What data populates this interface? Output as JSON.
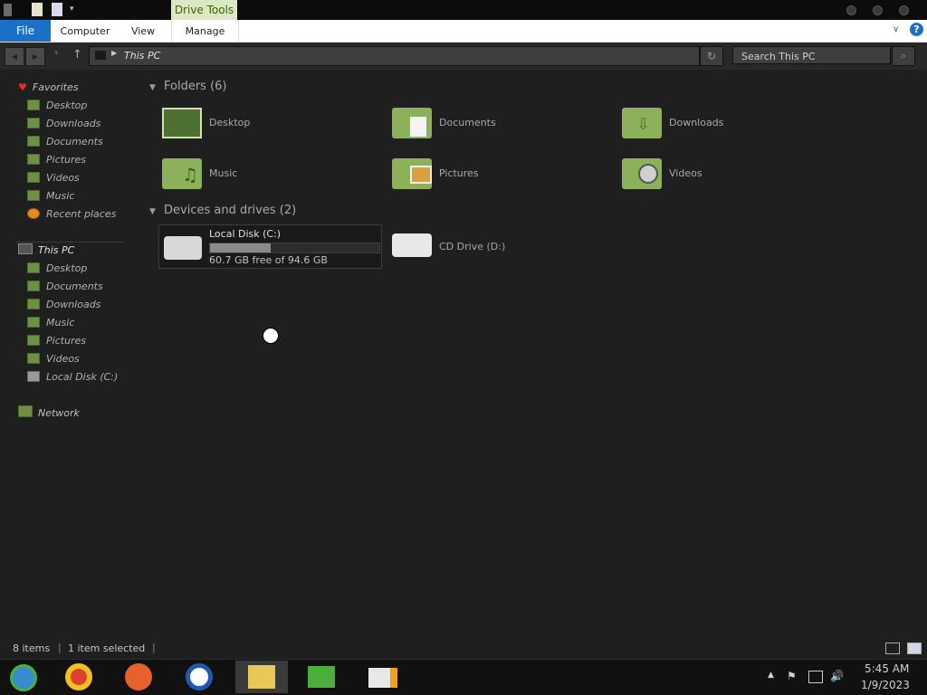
{
  "titlebar": {
    "contextual_tab": "Drive Tools"
  },
  "ribbon": {
    "tabs": [
      "File",
      "Computer",
      "View",
      "Manage"
    ]
  },
  "address": {
    "path": "This PC",
    "search_placeholder": "Search This PC"
  },
  "nav": {
    "favorites_label": "Favorites",
    "favorites": [
      "Desktop",
      "Downloads",
      "Documents",
      "Pictures",
      "Videos",
      "Music",
      "Recent places"
    ],
    "thispc_label": "This PC",
    "thispc": [
      "Desktop",
      "Documents",
      "Downloads",
      "Music",
      "Pictures",
      "Videos",
      "Local Disk (C:)"
    ],
    "network_label": "Network"
  },
  "folders": {
    "header": "Folders (6)",
    "items": [
      "Desktop",
      "Documents",
      "Downloads",
      "Music",
      "Pictures",
      "Videos"
    ]
  },
  "devices": {
    "header": "Devices and drives (2)",
    "local_disk": {
      "name": "Local Disk (C:)",
      "free": "60.7 GB free of 94.6 GB",
      "used_fraction": 0.358
    },
    "cd_drive": "CD Drive (D:)"
  },
  "status": {
    "items": "8 items",
    "selected": "1 item selected"
  },
  "tray": {
    "time": "5:45 AM",
    "date": "1/9/2023"
  },
  "colors": {
    "accent": "#1a71c7",
    "folder_green": "#8db05a",
    "background": "#1f1f1f"
  }
}
